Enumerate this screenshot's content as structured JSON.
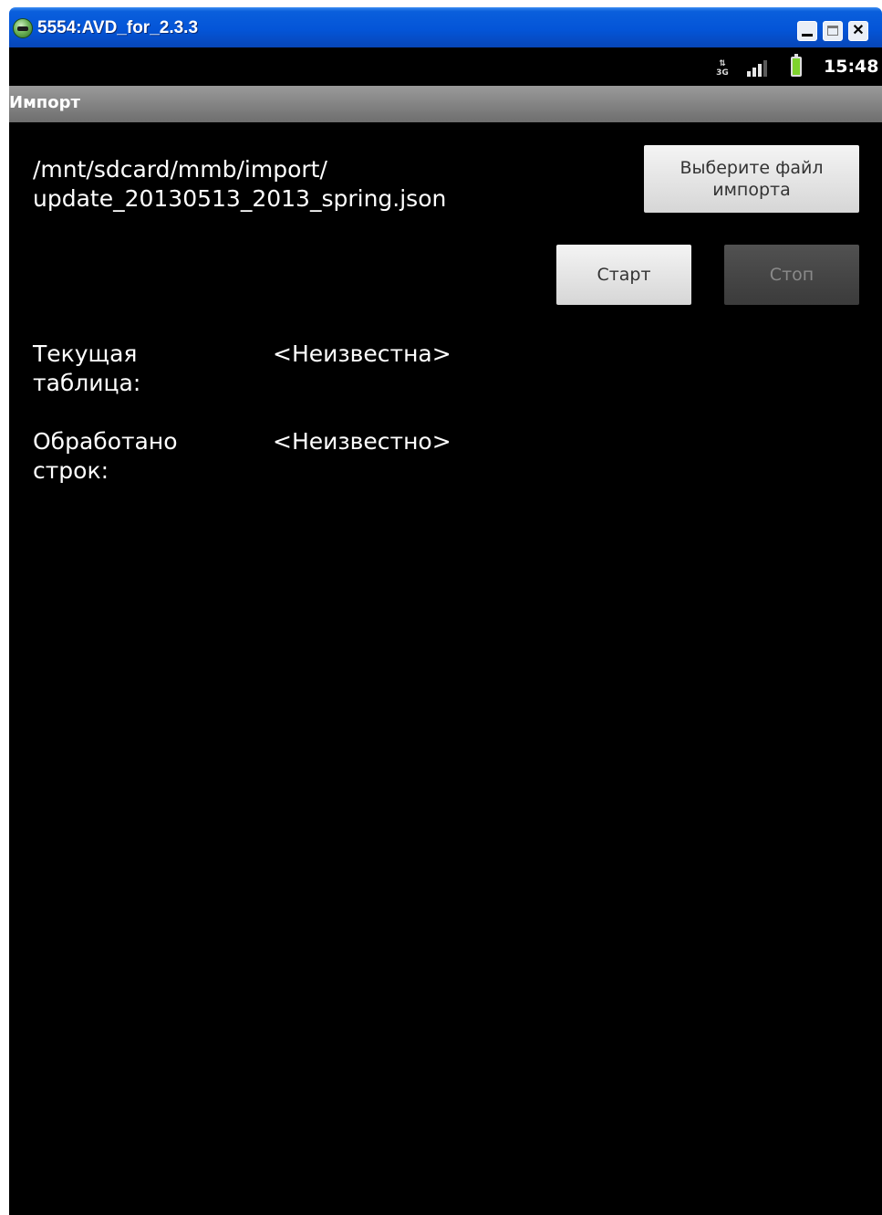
{
  "window": {
    "title": "5554:AVD_for_2.3.3",
    "close_glyph": "✕"
  },
  "status_bar": {
    "network_type": "3G",
    "time": "15:48"
  },
  "app": {
    "title": "Импорт"
  },
  "import": {
    "file_path_line1": "/mnt/sdcard/mmb/import/",
    "file_path_line2": "update_20130513_2013_spring.json",
    "choose_file_button": "Выберите файл импорта",
    "start_button": "Старт",
    "stop_button": "Стоп",
    "stop_enabled": false
  },
  "progress": {
    "current_table_label": "Текущая таблица:",
    "current_table_value": "<Неизвестна>",
    "rows_processed_label": "Обработано строк:",
    "rows_processed_value": "<Неизвестно>"
  },
  "colors": {
    "screen_background": "#000000",
    "header_gradient_top": "#9a9a9a",
    "titlebar_blue": "#0455d8",
    "battery_green": "#7fd32e"
  },
  "icons": [
    "emulator-app-icon",
    "minimize-icon",
    "maximize-icon",
    "close-icon",
    "network-3g-icon",
    "signal-strength-icon",
    "battery-icon"
  ]
}
